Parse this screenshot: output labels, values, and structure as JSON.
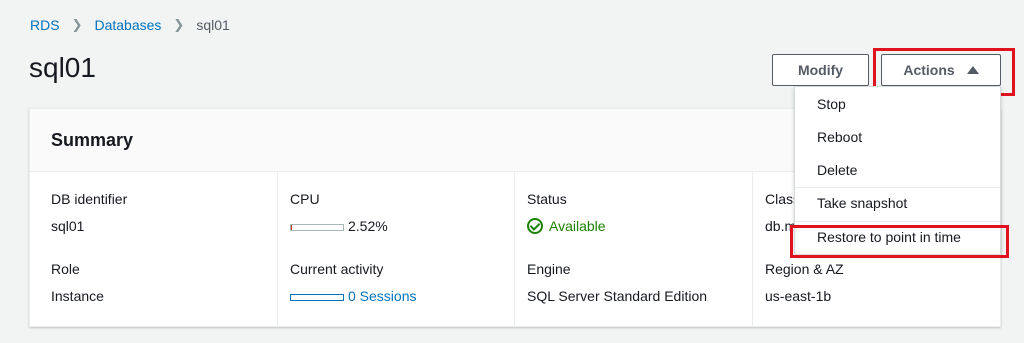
{
  "breadcrumb": {
    "rds": "RDS",
    "databases": "Databases",
    "current": "sql01"
  },
  "page_title": "sql01",
  "header": {
    "modify_label": "Modify",
    "actions_label": "Actions"
  },
  "summary": {
    "title": "Summary",
    "db_identifier": {
      "label": "DB identifier",
      "value": "sql01"
    },
    "role": {
      "label": "Role",
      "value": "Instance"
    },
    "cpu": {
      "label": "CPU",
      "value": "2.52%",
      "fraction": 0.0252
    },
    "current_activity": {
      "label": "Current activity",
      "value": "0 Sessions"
    },
    "status": {
      "label": "Status",
      "value": "Available",
      "icon": "check-circle-icon"
    },
    "engine": {
      "label": "Engine",
      "value": "SQL Server Standard Edition"
    },
    "class": {
      "label": "Class",
      "value": "db.m"
    },
    "region": {
      "label": "Region & AZ",
      "value": "us-east-1b"
    }
  },
  "actions_menu": {
    "items": [
      "Stop",
      "Reboot",
      "Delete",
      "Take snapshot",
      "Restore to point in time"
    ]
  },
  "colors": {
    "highlight": "#e0121d",
    "link": "#0073bb",
    "available": "#1d8102"
  }
}
